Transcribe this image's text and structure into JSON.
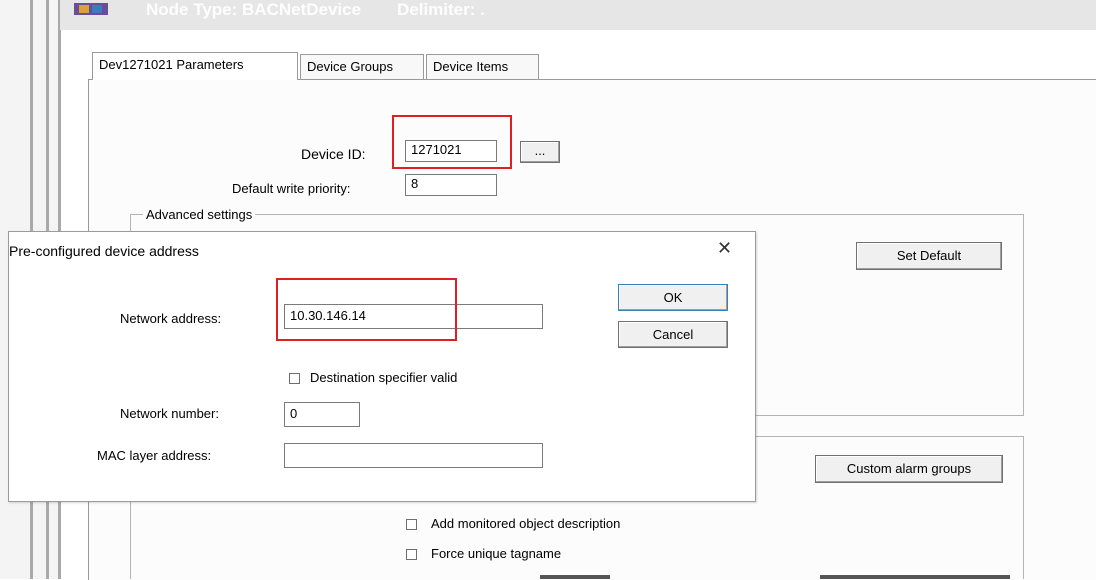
{
  "window": {
    "node_type": "Node Type: BACNetDevice",
    "delimiter": "Delimiter: ."
  },
  "tabs": [
    {
      "label": "Dev1271021 Parameters",
      "active": true
    },
    {
      "label": "Device Groups",
      "active": false
    },
    {
      "label": "Device Items",
      "active": false
    }
  ],
  "parameters": {
    "device_id_label": "Device ID:",
    "device_id_value": "1271021",
    "browse_label": "...",
    "write_priority_label": "Default write priority:",
    "write_priority_value": "8",
    "advanced_settings_title": "Advanced settings",
    "set_default_label": "Set Default",
    "custom_alarm_groups_label": "Custom alarm groups",
    "add_monitored_label": "Add monitored object description",
    "force_unique_label": "Force unique tagname"
  },
  "dialog": {
    "title": "Pre-configured device address",
    "close_glyph": "✕",
    "network_address_label": "Network address:",
    "network_address_value": "10.30.146.14",
    "ok_label": "OK",
    "cancel_label": "Cancel",
    "dest_specifier_label": "Destination specifier valid",
    "network_number_label": "Network number:",
    "network_number_value": "0",
    "mac_label": "MAC layer address:",
    "mac_value": ""
  },
  "colors": {
    "highlight": "#e02020"
  }
}
